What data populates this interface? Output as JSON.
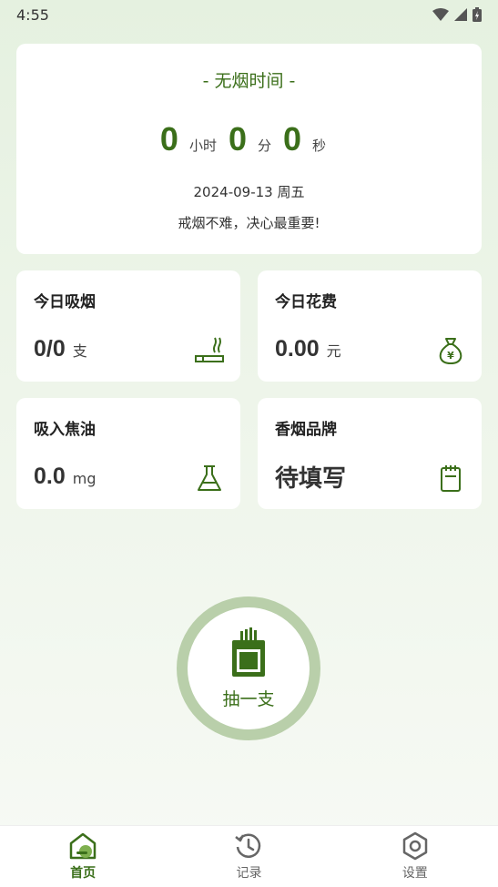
{
  "status_bar": {
    "time": "4:55"
  },
  "timer": {
    "title": "- 无烟时间 -",
    "hours": "0",
    "hours_unit": "小时",
    "minutes": "0",
    "minutes_unit": "分",
    "seconds": "0",
    "seconds_unit": "秒",
    "date": "2024-09-13 周五",
    "motto": "戒烟不难，决心最重要!"
  },
  "stats": {
    "today_smoke": {
      "title": "今日吸烟",
      "value": "0/0",
      "unit": "支",
      "icon": "cigarette-icon"
    },
    "today_cost": {
      "title": "今日花费",
      "value": "0.00",
      "unit": "元",
      "icon": "money-bag-icon"
    },
    "tar": {
      "title": "吸入焦油",
      "value": "0.0",
      "unit": "mg",
      "icon": "flask-icon"
    },
    "brand": {
      "title": "香烟品牌",
      "value": "待填写",
      "icon": "notepad-icon"
    }
  },
  "smoke_button": {
    "label": "抽一支",
    "icon": "cigarette-pack-icon"
  },
  "nav": [
    {
      "label": "首页",
      "icon": "home-icon",
      "active": true
    },
    {
      "label": "记录",
      "icon": "history-icon",
      "active": false
    },
    {
      "label": "设置",
      "icon": "settings-icon",
      "active": false
    }
  ],
  "colors": {
    "accent": "#3b6f1a",
    "ring": "#b9cfaa"
  }
}
